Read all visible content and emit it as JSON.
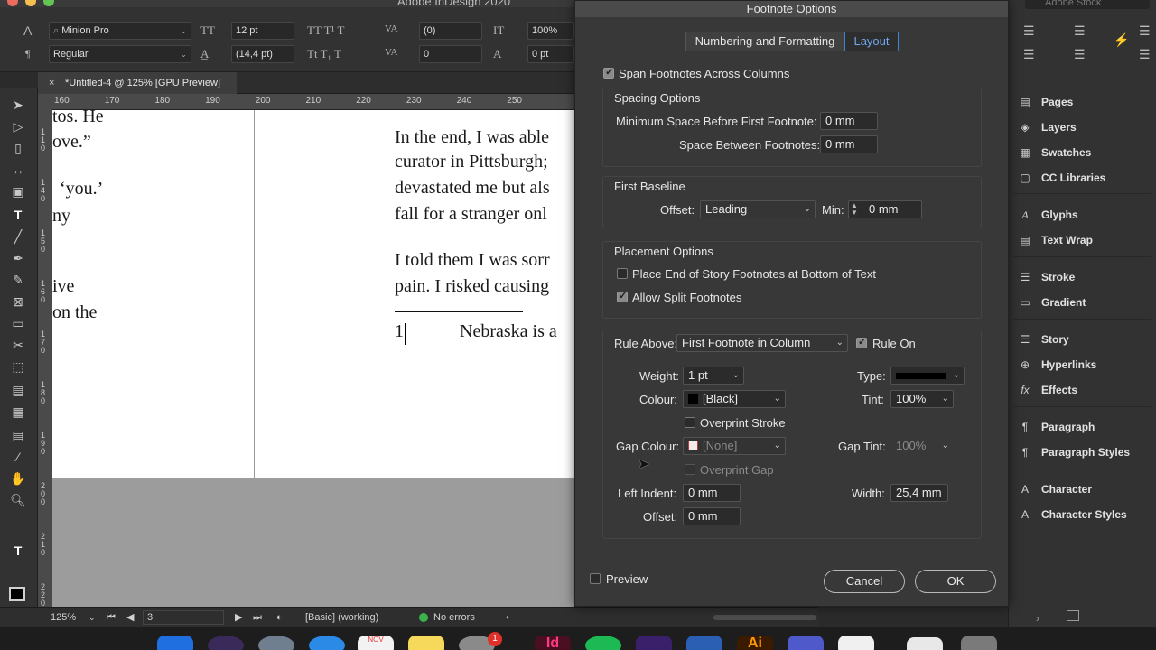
{
  "app": {
    "title": "Adobe InDesign 2020"
  },
  "control_bar": {
    "font_family": "Minion Pro",
    "font_style": "Regular",
    "font_size": "12 pt",
    "leading": "(14,4 pt)",
    "kerning": "(0)",
    "tracking": "0",
    "vertical_scale": "100%",
    "baseline_shift": "0 pt"
  },
  "document_tab": {
    "label": "*Untitled-4 @ 125% [GPU Preview]"
  },
  "ruler": {
    "h_ticks": [
      "160",
      "170",
      "180",
      "190",
      "200",
      "210",
      "220",
      "230",
      "240",
      "250"
    ],
    "v_ticks": [
      "1\n1\n0",
      "1\n4\n0",
      "1\n5\n0",
      "1\n6\n0",
      "1\n7\n0",
      "1\n8\n0",
      "1\n9\n0",
      "2\n0\n0",
      "2\n1\n0",
      "2\n2\n0"
    ]
  },
  "page_text": {
    "left": [
      "tos. He",
      "ove.”",
      "‘you.’",
      "ny",
      "ive",
      "on the"
    ],
    "right": [
      "In the end, I was able",
      "curator in Pittsburgh;",
      "devastated me but als",
      "fall for a stranger onl",
      "I told them I was sorr",
      "pain. I risked causing"
    ],
    "footnote_number": "1",
    "footnote_text": "Nebraska is a"
  },
  "status_bar": {
    "zoom": "125%",
    "page": "3",
    "preflight_profile": "[Basic] (working)",
    "errors": "No errors"
  },
  "dialog": {
    "title": "Footnote Options",
    "tabs": [
      "Numbering and Formatting",
      "Layout"
    ],
    "active_tab": "Layout",
    "span_footnotes": {
      "label": "Span Footnotes Across Columns",
      "checked": true
    },
    "spacing": {
      "heading": "Spacing Options",
      "min_space_label": "Minimum Space Before First Footnote:",
      "min_space_value": "0 mm",
      "between_label": "Space Between Footnotes:",
      "between_value": "0 mm"
    },
    "first_baseline": {
      "heading": "First Baseline",
      "offset_label": "Offset:",
      "offset_value": "Leading",
      "min_label": "Min:",
      "min_value": "0 mm"
    },
    "placement": {
      "heading": "Placement Options",
      "end_of_story": {
        "label": "Place End of Story Footnotes at Bottom of Text",
        "checked": false
      },
      "allow_split": {
        "label": "Allow Split Footnotes",
        "checked": true
      }
    },
    "rule": {
      "rule_above_label": "Rule Above:",
      "rule_above_value": "First Footnote in Column",
      "rule_on_label": "Rule On",
      "rule_on_checked": true,
      "weight_label": "Weight:",
      "weight_value": "1 pt",
      "type_label": "Type:",
      "colour_label": "Colour:",
      "colour_value": "[Black]",
      "tint_label": "Tint:",
      "tint_value": "100%",
      "overprint_stroke_label": "Overprint Stroke",
      "gap_colour_label": "Gap Colour:",
      "gap_colour_value": "[None]",
      "gap_tint_label": "Gap Tint:",
      "gap_tint_value": "100%",
      "overprint_gap_label": "Overprint Gap",
      "left_indent_label": "Left Indent:",
      "left_indent_value": "0 mm",
      "width_label": "Width:",
      "width_value": "25,4 mm",
      "offset_label": "Offset:",
      "offset_value": "0 mm"
    },
    "preview_label": "Preview",
    "cancel_label": "Cancel",
    "ok_label": "OK"
  },
  "panels": {
    "search_placeholder": "Adobe Stock",
    "items": [
      {
        "label": "Pages",
        "icon": "pages-icon"
      },
      {
        "label": "Layers",
        "icon": "layers-icon"
      },
      {
        "label": "Swatches",
        "icon": "swatches-icon"
      },
      {
        "label": "CC Libraries",
        "icon": "libraries-icon"
      },
      {
        "label": "Glyphs",
        "icon": "glyphs-icon"
      },
      {
        "label": "Text Wrap",
        "icon": "text-wrap-icon"
      },
      {
        "label": "Stroke",
        "icon": "stroke-icon"
      },
      {
        "label": "Gradient",
        "icon": "gradient-icon"
      },
      {
        "label": "Story",
        "icon": "story-icon"
      },
      {
        "label": "Hyperlinks",
        "icon": "hyperlinks-icon"
      },
      {
        "label": "Effects",
        "icon": "effects-icon"
      },
      {
        "label": "Paragraph",
        "icon": "paragraph-icon"
      },
      {
        "label": "Paragraph Styles",
        "icon": "paragraph-styles-icon"
      },
      {
        "label": "Character",
        "icon": "character-icon"
      },
      {
        "label": "Character Styles",
        "icon": "character-styles-icon"
      }
    ]
  },
  "dock": {
    "notification_badge": "1",
    "calendar_month": "NOV"
  },
  "colors": {
    "accent": "#3e82d7",
    "status_ok": "#3cb34a"
  }
}
